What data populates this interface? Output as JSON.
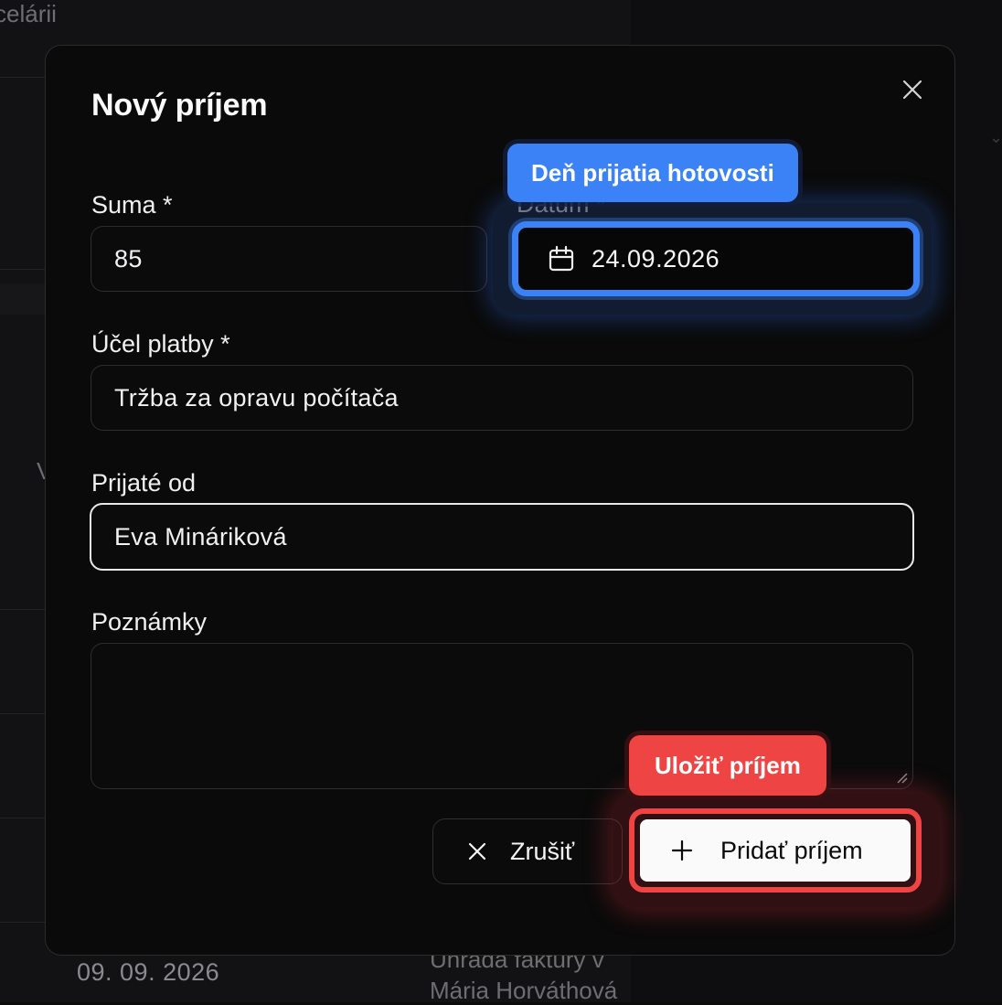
{
  "background": {
    "top_text": "celárii",
    "side_letter": "V",
    "row_date": "09. 09. 2026",
    "row_description": "Úhrada faktúry v",
    "row_person": "Mária Horváthová"
  },
  "modal": {
    "title": "Nový príjem",
    "fields": {
      "amount": {
        "label": "Suma *",
        "value": "85"
      },
      "date": {
        "label": "Dátum *",
        "value": "24.09.2026"
      },
      "purpose": {
        "label": "Účel platby *",
        "value": "Tržba za opravu počítača"
      },
      "received_from": {
        "label": "Prijaté od",
        "value": "Eva Mináriková"
      },
      "notes": {
        "label": "Poznámky",
        "value": ""
      }
    },
    "buttons": {
      "cancel": "Zrušiť",
      "submit": "Pridať príjem"
    }
  },
  "annotations": {
    "date_tooltip": "Deň prijatia hotovosti",
    "submit_tooltip": "Uložiť príjem"
  },
  "colors": {
    "highlight_blue": "#3b82f6",
    "highlight_red": "#ef4444",
    "modal_bg": "#0a0a0a"
  },
  "icons": [
    "close-icon",
    "calendar-icon",
    "x-icon",
    "plus-icon"
  ]
}
